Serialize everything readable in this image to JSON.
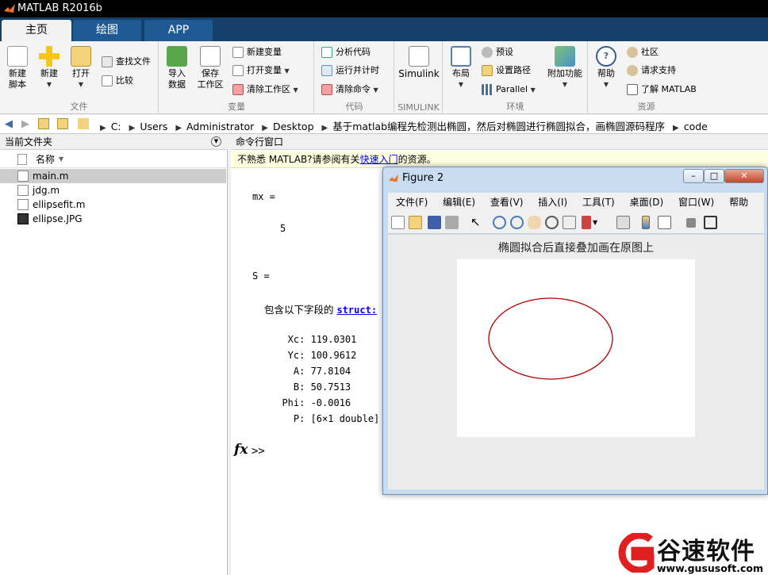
{
  "window": {
    "title": "MATLAB R2016b"
  },
  "tabs": [
    {
      "label": "主页",
      "active": true
    },
    {
      "label": "绘图",
      "active": false
    },
    {
      "label": "APP",
      "active": false
    }
  ],
  "ribbon": {
    "file": {
      "label": "文件",
      "new_script": "新建\n脚本",
      "new": "新建",
      "open": "打开",
      "find_files": "查找文件",
      "compare": "比较"
    },
    "variable": {
      "label": "变量",
      "import": "导入\n数据",
      "save_workspace": "保存\n工作区",
      "new_variable": "新建变量",
      "open_variable": "打开变量",
      "clear_workspace": "清除工作区"
    },
    "code": {
      "label": "代码",
      "analyze": "分析代码",
      "run_time": "运行并计时",
      "clear_commands": "清除命令"
    },
    "simulink": {
      "label": "SIMULINK",
      "button": "Simulink"
    },
    "environment": {
      "label": "环境",
      "layout": "布局",
      "preferences": "预设",
      "set_path": "设置路径",
      "parallel": "Parallel",
      "addons": "附加功能"
    },
    "resources": {
      "label": "资源",
      "help": "帮助",
      "community": "社区",
      "support": "请求支持",
      "learn": "了解 MATLAB"
    }
  },
  "address": {
    "segments": [
      "C:",
      "Users",
      "Administrator",
      "Desktop",
      "基于matlab编程先检测出椭圆，然后对椭圆进行椭圆拟合，画椭圆源码程序",
      "code"
    ]
  },
  "current_folder": {
    "title": "当前文件夹",
    "column_name": "名称",
    "files": [
      {
        "name": "main.m",
        "selected": true,
        "icon": "m-file-icon"
      },
      {
        "name": "jdg.m",
        "selected": false,
        "icon": "m-file-icon"
      },
      {
        "name": "ellipsefit.m",
        "selected": false,
        "icon": "m-file-icon"
      },
      {
        "name": "ellipse.JPG",
        "selected": false,
        "icon": "jpg-file-icon"
      }
    ]
  },
  "command_window": {
    "title": "命令行窗口",
    "notice_prefix": "不熟悉 MATLAB?请参阅有关",
    "notice_link": "快速入门",
    "notice_suffix": "的资源。",
    "mx_label": "mx =",
    "mx_value": "5",
    "s_label": "S =",
    "struct_text": "包含以下字段的 ",
    "struct_link": "struct:",
    "fields": [
      "   Xc: 119.0301",
      "   Yc: 100.9612",
      "    A: 77.8104",
      "    B: 50.7513",
      "  Phi: -0.0016",
      "    P: [6×1 double]"
    ],
    "prompt": ">>",
    "fx": "fx"
  },
  "figure": {
    "title": "Figure 2",
    "menu": [
      "文件(F)",
      "编辑(E)",
      "查看(V)",
      "插入(I)",
      "工具(T)",
      "桌面(D)",
      "窗口(W)",
      "帮助(H)"
    ],
    "plot_title": "椭圆拟合后直接叠加画在原图上",
    "ellipse_color": "#b00000"
  },
  "watermark": {
    "brand": "谷速软件",
    "url": "www.gususoft.com",
    "color": "#e02020"
  }
}
